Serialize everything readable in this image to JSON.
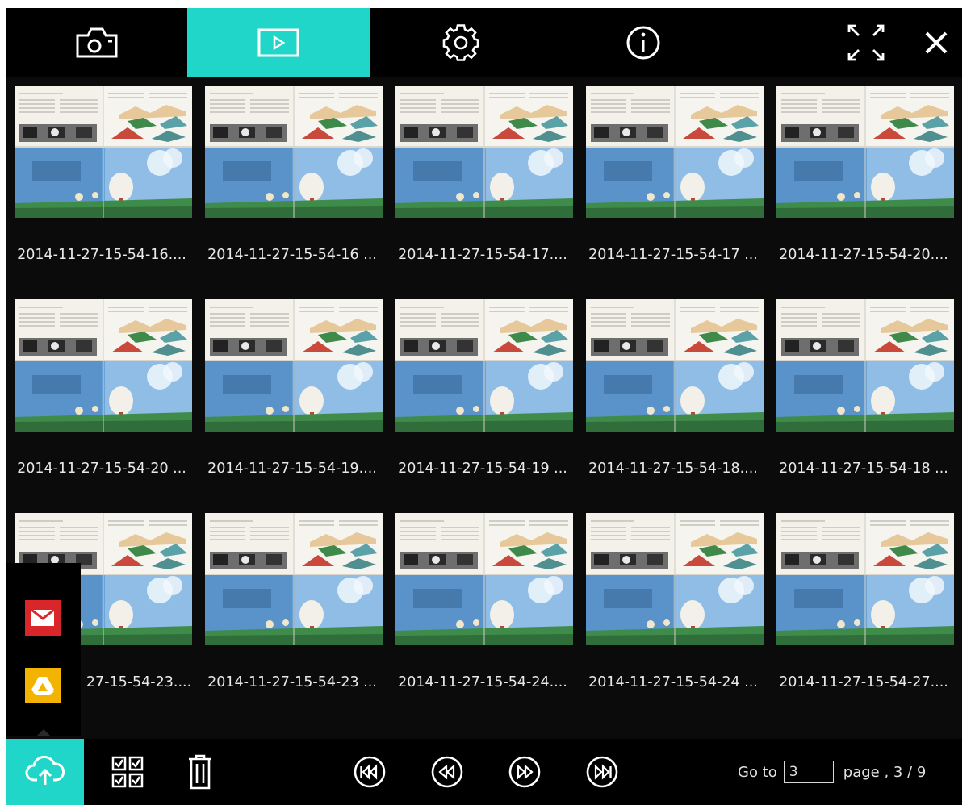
{
  "toolbar": {
    "tabs": [
      {
        "name": "camera",
        "icon": "camera-icon",
        "active": false
      },
      {
        "name": "play",
        "icon": "play-icon",
        "active": true
      },
      {
        "name": "settings",
        "icon": "gear-icon",
        "active": false
      },
      {
        "name": "info",
        "icon": "info-icon",
        "active": false
      }
    ],
    "fullscreen_icon": "fullscreen-icon",
    "close_icon": "close-icon"
  },
  "thumbnails": [
    {
      "caption": "2014-11-27-15-54-16...."
    },
    {
      "caption": "2014-11-27-15-54-16 ..."
    },
    {
      "caption": "2014-11-27-15-54-17...."
    },
    {
      "caption": "2014-11-27-15-54-17 ..."
    },
    {
      "caption": "2014-11-27-15-54-20...."
    },
    {
      "caption": "2014-11-27-15-54-20 ..."
    },
    {
      "caption": "2014-11-27-15-54-19...."
    },
    {
      "caption": "2014-11-27-15-54-19 ..."
    },
    {
      "caption": "2014-11-27-15-54-18...."
    },
    {
      "caption": "2014-11-27-15-54-18 ..."
    },
    {
      "caption": "27-15-54-23...."
    },
    {
      "caption": "2014-11-27-15-54-23 ..."
    },
    {
      "caption": "2014-11-27-15-54-24...."
    },
    {
      "caption": "2014-11-27-15-54-24 ..."
    },
    {
      "caption": "2014-11-27-15-54-27...."
    }
  ],
  "share_menu": {
    "items": [
      "email-icon",
      "google-drive-icon"
    ]
  },
  "bottom": {
    "goto_label": "Go to",
    "goto_value": "3",
    "page_label": "page , 3 / 9",
    "icons": [
      "cloud-upload-icon",
      "select-all-icon",
      "trash-icon",
      "first-page-icon",
      "previous-page-icon",
      "next-page-icon",
      "last-page-icon"
    ]
  },
  "colors": {
    "accent": "#1fd6c8",
    "background": "#0b0b0b",
    "email": "#d9262b",
    "drive": "#f2b400"
  }
}
